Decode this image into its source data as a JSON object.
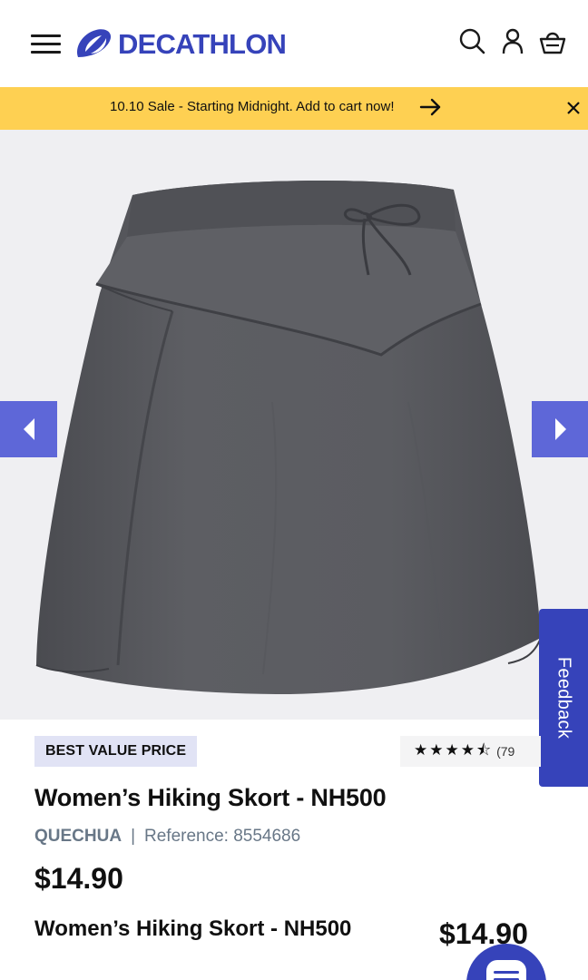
{
  "header": {
    "logo_text": "DECATHLON",
    "menu_icon": "hamburger-menu-icon",
    "search_icon": "search-icon",
    "account_icon": "user-icon",
    "cart_icon": "basket-icon",
    "brand_color": "#3643ba"
  },
  "banner": {
    "text": "10.10 Sale - Starting Midnight. Add to cart now!",
    "arrow_icon": "arrow-right-icon",
    "close_icon": "close-icon",
    "background": "#fed052"
  },
  "gallery": {
    "prev_icon": "chevron-left-icon",
    "next_icon": "chevron-right-icon",
    "nav_color": "#5e67d8"
  },
  "feedback": {
    "label": "Feedback"
  },
  "product": {
    "badge": "BEST VALUE PRICE",
    "rating_stars": "★★★★⯪",
    "rating_value": 4.5,
    "rating_count": "(79",
    "title": "Women’s Hiking Skort - NH500",
    "brand": "QUECHUA",
    "separator": "|",
    "reference": "Reference: 8554686",
    "price": "$14.90"
  },
  "sticky_bar": {
    "title": "Women’s Hiking Skort - NH500",
    "price": "$14.90",
    "chat_icon": "chat-icon"
  }
}
